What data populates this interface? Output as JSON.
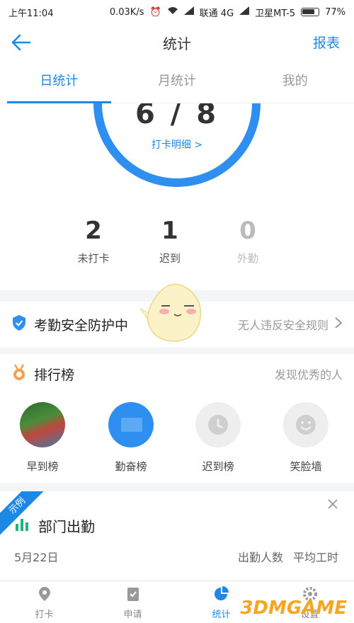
{
  "status_bar": {
    "time": "上午11:04",
    "network_speed": "0.03K/s",
    "carrier1": "联通 4G",
    "carrier2": "卫星MT-5",
    "battery": "77%"
  },
  "navbar": {
    "title": "统计",
    "right_action": "报表"
  },
  "tabs": [
    {
      "label": "日统计",
      "active": true
    },
    {
      "label": "月统计",
      "active": false
    },
    {
      "label": "我的",
      "active": false
    }
  ],
  "summary": {
    "fraction": "6 / 8",
    "detail_link": "打卡明细 >",
    "ring_progress": 0.75,
    "stats": [
      {
        "value": "2",
        "label": "未打卡"
      },
      {
        "value": "1",
        "label": "迟到"
      },
      {
        "value": "0",
        "label": "外勤"
      }
    ]
  },
  "security": {
    "label": "考勤安全防护中",
    "hint": "无人违反安全规则"
  },
  "ranking": {
    "label": "排行榜",
    "hint": "发现优秀的人",
    "items": [
      {
        "label": "早到榜"
      },
      {
        "label": "勤奋榜"
      },
      {
        "label": "迟到榜"
      },
      {
        "label": "笑脸墙"
      }
    ]
  },
  "department": {
    "badge": "示例",
    "title": "部门出勤",
    "date": "5月22日",
    "col1": "出勤人数",
    "col2": "平均工时"
  },
  "bottom_nav": [
    {
      "label": "打卡",
      "icon": "location-pin-icon"
    },
    {
      "label": "申请",
      "icon": "clipboard-check-icon"
    },
    {
      "label": "统计",
      "icon": "pie-chart-icon",
      "active": true
    },
    {
      "label": "设置",
      "icon": "gear-icon"
    }
  ],
  "watermark": "3DMGAME",
  "colors": {
    "accent": "#1e88e5",
    "text": "#333333",
    "muted": "#999999"
  }
}
